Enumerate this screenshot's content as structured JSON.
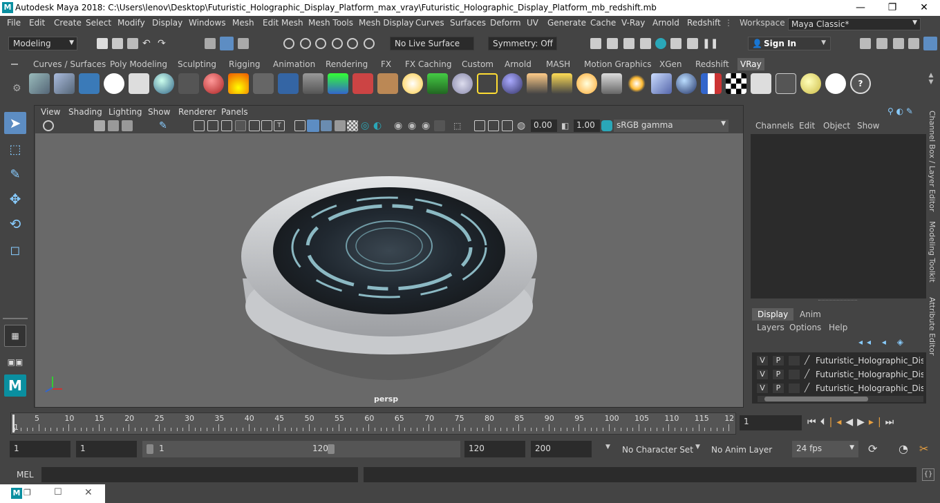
{
  "window": {
    "title": "Autodesk Maya 2018: C:\\Users\\lenov\\Desktop\\Futuristic_Holographic_Display_Platform_max_vray\\Futuristic_Holographic_Display_Platform_mb_redshift.mb",
    "minimize": "—",
    "maximize": "❐",
    "close": "✕"
  },
  "menubar": {
    "items": [
      "File",
      "Edit",
      "Create",
      "Select",
      "Modify",
      "Display",
      "Windows",
      "Mesh",
      "Edit Mesh",
      "Mesh Tools",
      "Mesh Display",
      "Curves",
      "Surfaces",
      "Deform",
      "UV",
      "Generate",
      "Cache",
      "V-Ray",
      "Arnold",
      "Redshift"
    ],
    "workspace_label": "Workspace :",
    "workspace_value": "Maya Classic*"
  },
  "statusline": {
    "mode": "Modeling",
    "live_surface": "No Live Surface",
    "symmetry": "Symmetry: Off",
    "sign_in": "Sign In"
  },
  "shelf": {
    "tabs": [
      "Curves / Surfaces",
      "Poly Modeling",
      "Sculpting",
      "Rigging",
      "Animation",
      "Rendering",
      "FX",
      "FX Caching",
      "Custom",
      "Arnold",
      "MASH",
      "Motion Graphics",
      "XGen",
      "Redshift",
      "VRay"
    ],
    "active_tab": "VRay"
  },
  "viewport": {
    "menus": [
      "View",
      "Shading",
      "Lighting",
      "Show",
      "Renderer",
      "Panels"
    ],
    "exposure": "0.00",
    "gamma": "1.00",
    "color_space": "sRGB gamma",
    "camera": "persp"
  },
  "channelbox": {
    "menus": [
      "Channels",
      "Edit",
      "Object",
      "Show"
    ]
  },
  "layereditor": {
    "tabs": [
      "Display",
      "Anim"
    ],
    "active_tab": "Display",
    "menus": [
      "Layers",
      "Options",
      "Help"
    ],
    "layers": [
      {
        "v": "V",
        "p": "P",
        "name": "Futuristic_Holographic_Display"
      },
      {
        "v": "V",
        "p": "P",
        "name": "Futuristic_Holographic_Display"
      },
      {
        "v": "V",
        "p": "P",
        "name": "Futuristic_Holographic_Display"
      }
    ]
  },
  "side_tabs": [
    "Channel Box / Layer Editor",
    "Modeling Toolkit",
    "Attribute Editor"
  ],
  "timeline": {
    "ticks": [
      "5",
      "10",
      "15",
      "20",
      "25",
      "30",
      "35",
      "40",
      "45",
      "50",
      "55",
      "60",
      "65",
      "70",
      "75",
      "80",
      "85",
      "90",
      "95",
      "100",
      "105",
      "110",
      "115",
      "12"
    ],
    "current_frame": "1",
    "start_marker": "1"
  },
  "range": {
    "start": "1",
    "playback_start": "1",
    "slider_start": "1",
    "slider_end": "120",
    "playback_end": "120",
    "end": "200",
    "character_set": "No Character Set",
    "anim_layer": "No Anim Layer",
    "fps": "24 fps"
  },
  "commandline": {
    "label": "MEL"
  }
}
